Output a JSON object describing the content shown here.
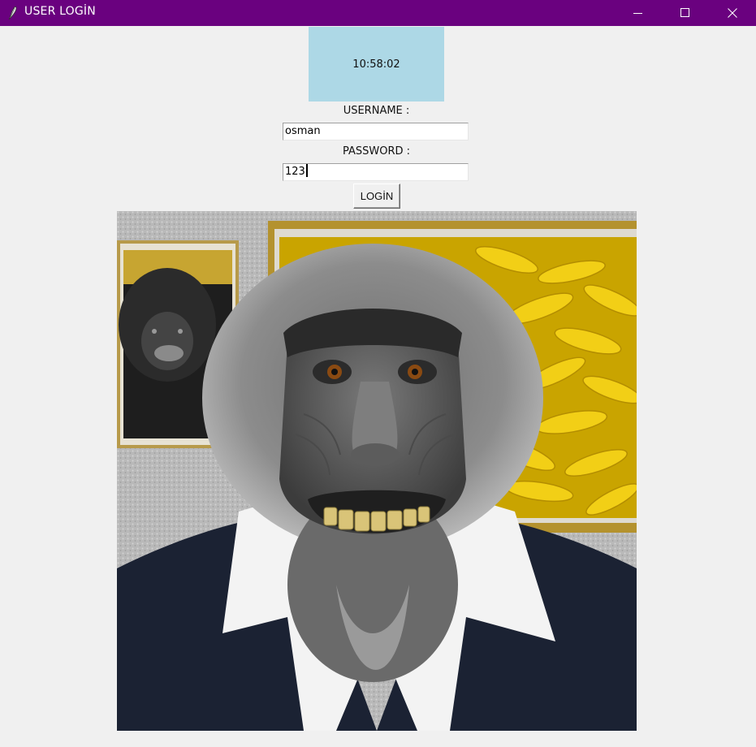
{
  "window": {
    "title": "USER LOGİN",
    "icon": "feather-icon",
    "controls": [
      "minimize-icon",
      "maximize-icon",
      "close-icon"
    ],
    "titlebar_color": "#6a017f"
  },
  "clock": {
    "time": "10:58:02",
    "background": "#add8e6"
  },
  "form": {
    "username_label": "USERNAME :",
    "username_value": "osman",
    "password_label": "PASSWORD :",
    "password_value": "123",
    "login_label": "LOGİN"
  },
  "image": {
    "subject": "monkey in suit with banana paintings"
  }
}
